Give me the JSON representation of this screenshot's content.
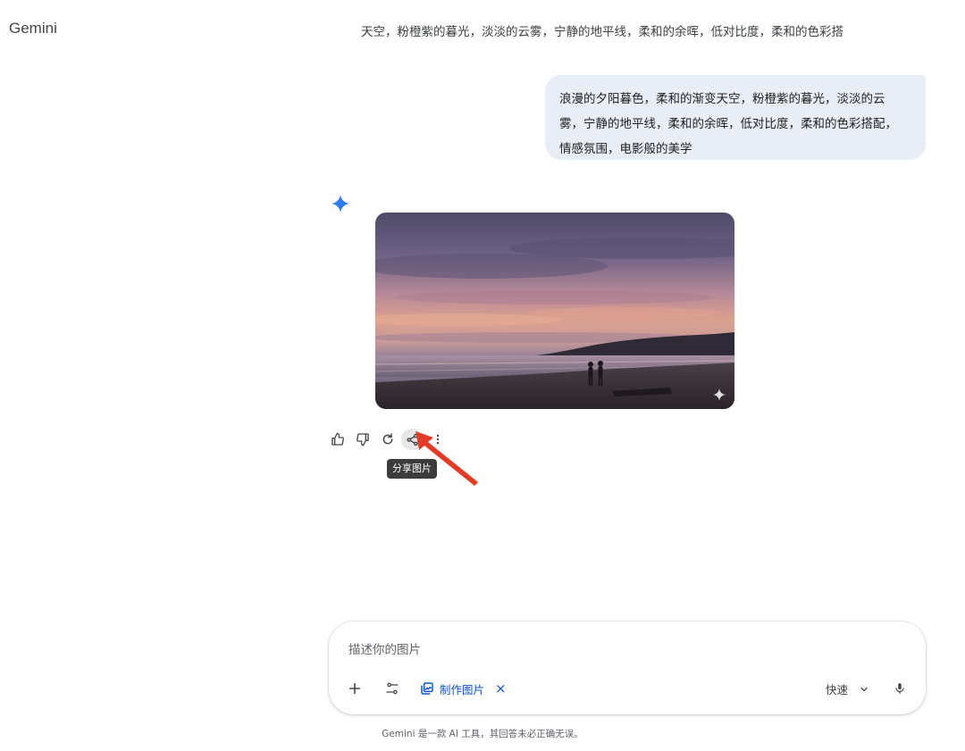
{
  "app": {
    "name": "Gemini"
  },
  "conversation": {
    "title": "天空，粉橙紫的暮光，淡淡的云雾，宁静的地平线，柔和的余晖，低对比度，柔和的色彩搭",
    "user_prompt_lines": [
      "浪漫的夕阳暮色，柔和的渐变天空，粉橙紫的暮光，淡淡的云",
      "雾，宁静的地平线，柔和的余晖，低对比度，柔和的色彩搭配，",
      "情感氛围，电影般的美学"
    ]
  },
  "response": {
    "image_alt_icon": "sparkle-watermark-icon",
    "actions": [
      {
        "name": "thumbs-up-icon"
      },
      {
        "name": "thumbs-down-icon"
      },
      {
        "name": "regenerate-icon"
      },
      {
        "name": "share-icon"
      },
      {
        "name": "more-vert-icon"
      }
    ],
    "tooltip": "分享图片"
  },
  "input": {
    "placeholder": "描述你的图片",
    "tool_chip": "制作图片",
    "speed_label": "快速"
  },
  "footer": {
    "disclaimer": "Gemini 是一款 AI 工具，其回答未必正确无误。"
  },
  "colors": {
    "accent_blue": "#0b57d0",
    "bubble_bg": "#e9eef6",
    "arrow_red": "#e53a25"
  }
}
